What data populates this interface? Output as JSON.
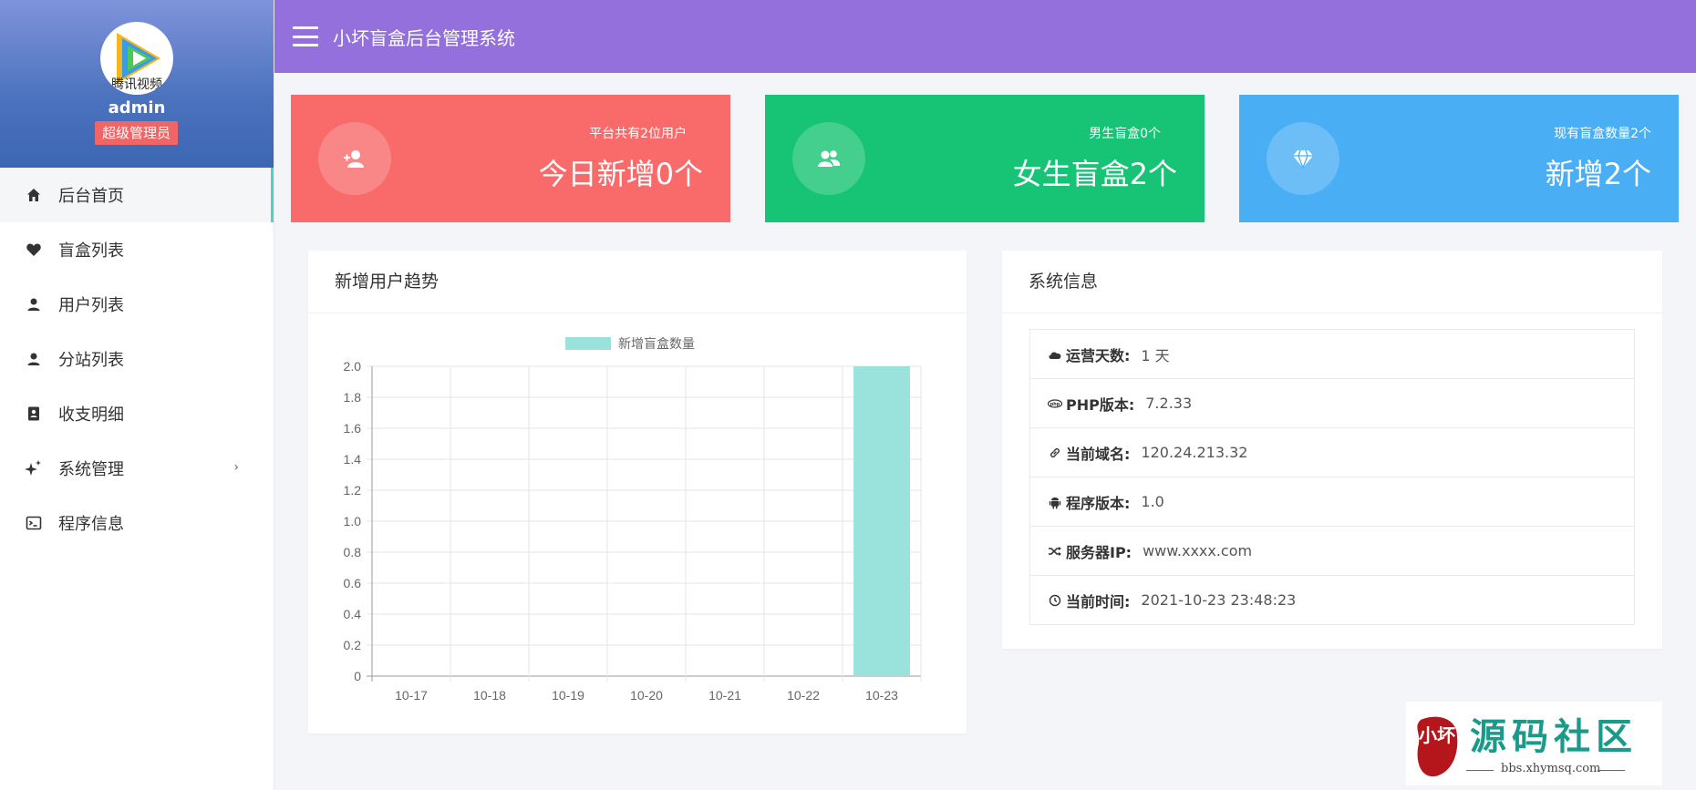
{
  "header": {
    "title": "小坏盲盒后台管理系统"
  },
  "profile": {
    "avatar_caption": "腾讯视频",
    "name": "admin",
    "role": "超级管理员"
  },
  "sidebar": {
    "items": [
      {
        "label": "后台首页",
        "icon": "home-icon"
      },
      {
        "label": "盲盒列表",
        "icon": "heart-icon"
      },
      {
        "label": "用户列表",
        "icon": "user-icon"
      },
      {
        "label": "分站列表",
        "icon": "user-icon"
      },
      {
        "label": "收支明细",
        "icon": "ledger-icon"
      },
      {
        "label": "系统管理",
        "icon": "sparkle-icon",
        "arrow": "›"
      },
      {
        "label": "程序信息",
        "icon": "terminal-icon"
      }
    ]
  },
  "stats": [
    {
      "small": "平台共有2位用户",
      "big": "今日新增0个",
      "icon": "add-user-icon",
      "color": "#f96a6a"
    },
    {
      "small": "男生盲盒0个",
      "big": "女生盲盒2个",
      "icon": "users-icon",
      "color": "#17c374"
    },
    {
      "small": "现有盲盒数量2个",
      "big": "新增2个",
      "icon": "diamond-icon",
      "color": "#49aef4"
    }
  ],
  "chart_panel": {
    "title": "新增用户趋势"
  },
  "chart_data": {
    "type": "bar",
    "categories": [
      "10-17",
      "10-18",
      "10-19",
      "10-20",
      "10-21",
      "10-22",
      "10-23"
    ],
    "series": [
      {
        "name": "新增盲盒数量",
        "values": [
          0,
          0,
          0,
          0,
          0,
          0,
          2
        ],
        "color": "#9ae3dc"
      }
    ],
    "ylim": [
      0,
      2.0
    ],
    "yticks": [
      "0",
      "0.2",
      "0.4",
      "0.6",
      "0.8",
      "1.0",
      "1.2",
      "1.4",
      "1.6",
      "1.8",
      "2.0"
    ],
    "grid": true,
    "legend": "top-center"
  },
  "info_panel": {
    "title": "系统信息",
    "rows": [
      {
        "icon": "cloud-icon",
        "label": "运营天数:",
        "value": "1 天"
      },
      {
        "icon": "php-icon",
        "label": "PHP版本:",
        "value": "7.2.33"
      },
      {
        "icon": "link-icon",
        "label": "当前域名:",
        "value": "120.24.213.32"
      },
      {
        "icon": "android-icon",
        "label": "程序版本:",
        "value": "1.0"
      },
      {
        "icon": "shuffle-icon",
        "label": "服务器IP:",
        "value": "www.xxxx.com"
      },
      {
        "icon": "clock-icon",
        "label": "当前时间:",
        "value": "2021-10-23 23:48:23"
      }
    ]
  },
  "watermark": {
    "title": "源码社区",
    "url": "bbs.xhymsq.com",
    "seal_text": "小坏"
  }
}
